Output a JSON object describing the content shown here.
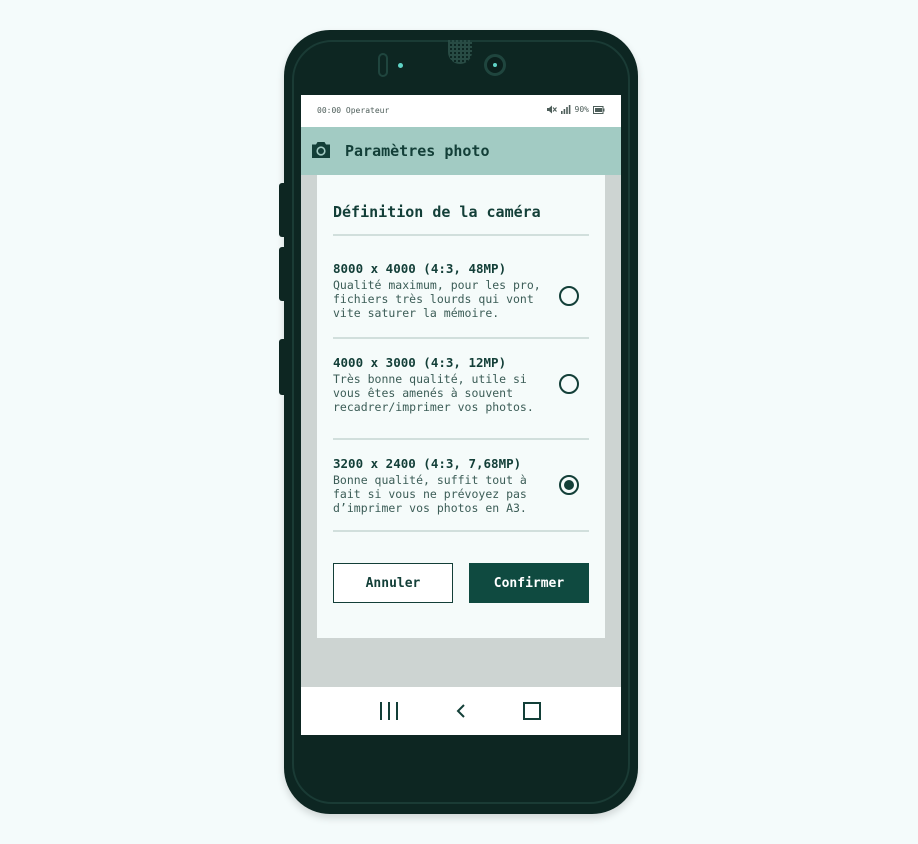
{
  "statusbar": {
    "time": "00:00",
    "operator": "Operateur",
    "battery": "90%",
    "icons": [
      "mute-icon",
      "signal-icon",
      "battery-icon"
    ]
  },
  "appbar": {
    "title": "Paramètres photo",
    "icon": "camera-icon"
  },
  "dialog": {
    "title": "Définition de la caméra",
    "options": [
      {
        "title": "8000 x 4000 (4:3, 48MP)",
        "description": "Qualité maximum, pour les pro, fichiers très lourds qui vont vite saturer la mémoire.",
        "selected": false
      },
      {
        "title": "4000 x 3000 (4:3, 12MP)",
        "description": "Très bonne qualité, utile si vous êtes amenés à souvent recadrer/imprimer vos photos.",
        "selected": false
      },
      {
        "title": "3200 x 2400 (4:3, 7,68MP)",
        "description": "Bonne qualité, suffit tout à fait si vous ne prévoyez pas d’imprimer vos photos en A3.",
        "selected": true
      }
    ],
    "cancel_label": "Annuler",
    "confirm_label": "Confirmer"
  },
  "navbar": {
    "items": [
      "recents-icon",
      "back-icon",
      "home-icon"
    ]
  },
  "colors": {
    "accent": "#0f4a40",
    "appbar": "#a2cbc3",
    "phone": "#0d2622",
    "background": "#f4fbfb"
  }
}
